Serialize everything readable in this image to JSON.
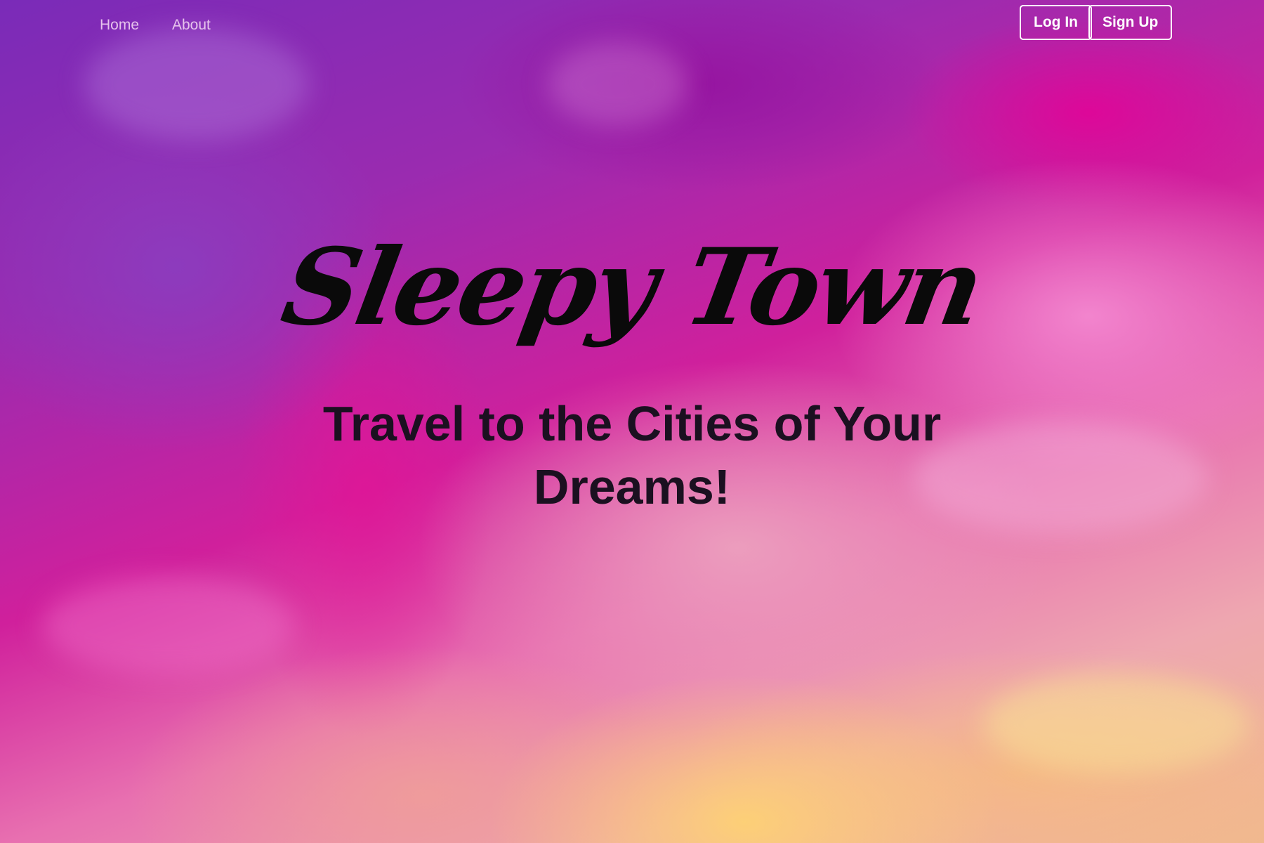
{
  "nav": {
    "links": [
      {
        "label": "Home"
      },
      {
        "label": "About"
      }
    ],
    "login_label": "Log In",
    "signup_label": "Sign Up"
  },
  "hero": {
    "title": "Sleepy Town",
    "subtitle": "Travel to the Cities of Your Dreams!"
  },
  "colors": {
    "nav_link": "#e6c2ec",
    "button_border": "#ffffff",
    "title": "#0a0a0a",
    "subtitle": "#1b1020",
    "sky_top": "#7a2bb8",
    "sky_middle": "#d0209c",
    "sky_bottom": "#f0b890"
  }
}
